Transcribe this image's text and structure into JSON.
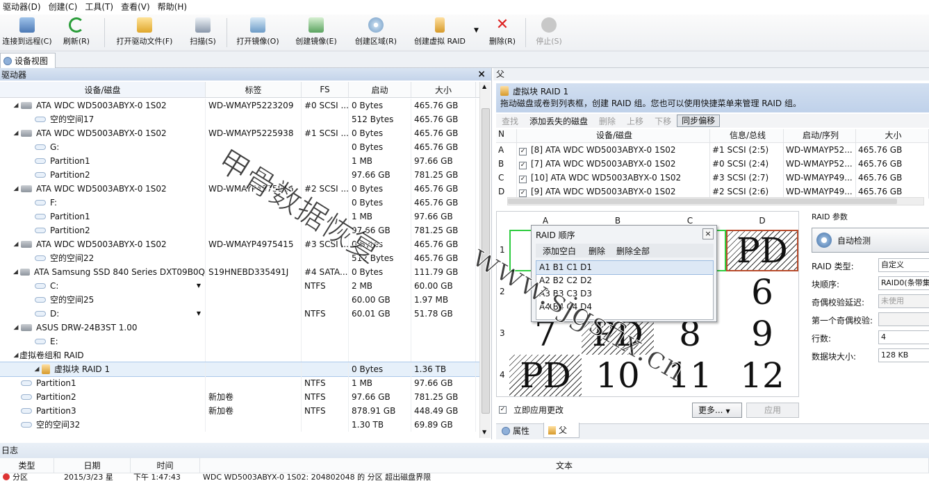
{
  "menu": [
    "驱动器(D)",
    "创建(C)",
    "工具(T)",
    "查看(V)",
    "帮助(H)"
  ],
  "toolbar": {
    "connect": "连接到远程(C)",
    "refresh": "刷新(R)",
    "open_drive_file": "打开驱动文件(F)",
    "scan": "扫描(S)",
    "open_image": "打开镜像(O)",
    "create_image": "创建镜像(E)",
    "create_region": "创建区域(R)",
    "create_virtual_raid": "创建虚拟 RAID",
    "delete": "删除(R)",
    "stop": "停止(S)"
  },
  "tabs": {
    "devices": "设备视图"
  },
  "left": {
    "title": "驱动器",
    "close": "×",
    "columns": [
      "设备/磁盘",
      "标签",
      "FS",
      "启动",
      "大小"
    ],
    "rows": [
      {
        "name": "ATA WDC WD5003ABYX-0 1S02",
        "label": "WD-WMAYP5223209",
        "fs": "#0 SCSI ...",
        "start": "0 Bytes",
        "size": "465.76 GB"
      },
      {
        "name": "空的空间17",
        "label": "",
        "fs": "",
        "start": "512 Bytes",
        "size": "465.76 GB"
      },
      {
        "name": "ATA WDC WD5003ABYX-0 1S02",
        "label": "WD-WMAYP5225938",
        "fs": "#1 SCSI ...",
        "start": "0 Bytes",
        "size": "465.76 GB"
      },
      {
        "name": "G:",
        "label": "",
        "fs": "",
        "start": "0 Bytes",
        "size": "465.76 GB"
      },
      {
        "name": "Partition1",
        "label": "",
        "fs": "",
        "start": "1 MB",
        "size": "97.66 GB"
      },
      {
        "name": "Partition2",
        "label": "",
        "fs": "",
        "start": "97.66 GB",
        "size": "781.25 GB"
      },
      {
        "name": "ATA WDC WD5003ABYX-0 1S02",
        "label": "WD-WMAYP4975816",
        "fs": "#2 SCSI ...",
        "start": "0 Bytes",
        "size": "465.76 GB"
      },
      {
        "name": "F:",
        "label": "",
        "fs": "",
        "start": "0 Bytes",
        "size": "465.76 GB"
      },
      {
        "name": "Partition1",
        "label": "",
        "fs": "",
        "start": "1 MB",
        "size": "97.66 GB"
      },
      {
        "name": "Partition2",
        "label": "",
        "fs": "",
        "start": "97.66 GB",
        "size": "781.25 GB"
      },
      {
        "name": "ATA WDC WD5003ABYX-0 1S02",
        "label": "WD-WMAYP4975415",
        "fs": "#3 SCSI ...",
        "start": "0 Bytes",
        "size": "465.76 GB"
      },
      {
        "name": "空的空间22",
        "label": "",
        "fs": "",
        "start": "512 Bytes",
        "size": "465.76 GB"
      },
      {
        "name": "ATA Samsung SSD 840 Series DXT09B0Q",
        "label": "S19HNEBD335491J",
        "fs": "#4 SATA...",
        "start": "0 Bytes",
        "size": "111.79 GB"
      },
      {
        "name": "C:",
        "label": "",
        "fs": "NTFS",
        "start": "2 MB",
        "size": "60.00 GB"
      },
      {
        "name": "空的空间25",
        "label": "",
        "fs": "",
        "start": "60.00 GB",
        "size": "1.97 MB"
      },
      {
        "name": "D:",
        "label": "",
        "fs": "NTFS",
        "start": "60.01 GB",
        "size": "51.78 GB"
      },
      {
        "name": "ASUS DRW-24B3ST 1.00",
        "label": "",
        "fs": "",
        "start": "",
        "size": ""
      },
      {
        "name": "E:",
        "label": "",
        "fs": "",
        "start": "",
        "size": ""
      },
      {
        "name": "虚拟卷组和 RAID",
        "label": "",
        "fs": "",
        "start": "",
        "size": ""
      },
      {
        "name": "虚拟块 RAID 1",
        "label": "",
        "fs": "",
        "start": "0 Bytes",
        "size": "1.36 TB"
      },
      {
        "name": "Partition1",
        "label": "",
        "fs": "NTFS",
        "start": "1 MB",
        "size": "97.66 GB"
      },
      {
        "name": "Partition2",
        "label": "新加卷",
        "fs": "NTFS",
        "start": "97.66 GB",
        "size": "781.25 GB"
      },
      {
        "name": "Partition3",
        "label": "新加卷",
        "fs": "NTFS",
        "start": "878.91 GB",
        "size": "448.49 GB"
      },
      {
        "name": "空的空间32",
        "label": "",
        "fs": "",
        "start": "1.30 TB",
        "size": "69.89 GB"
      }
    ]
  },
  "right": {
    "title": "父",
    "header_title": "虚拟块 RAID 1",
    "header_desc": "拖动磁盘或卷到列表框，创建 RAID 组。您也可以使用快捷菜单来管理 RAID 组。",
    "tools": {
      "find": "查找",
      "add_missing": "添加丢失的磁盘",
      "delete": "删除",
      "up": "上移",
      "down": "下移",
      "sync": "同步偏移"
    },
    "columns": [
      "N",
      "设备/磁盘",
      "信息/总线",
      "启动/序列",
      "大小"
    ],
    "rows": [
      {
        "n": "A",
        "disk": "[8] ATA WDC WD5003ABYX-0 1S02",
        "bus": "#1 SCSI (2:5)",
        "serial": "WD-WMAYP52...",
        "size": "465.76 GB"
      },
      {
        "n": "B",
        "disk": "[7] ATA WDC WD5003ABYX-0 1S02",
        "bus": "#0 SCSI (2:4)",
        "serial": "WD-WMAYP52...",
        "size": "465.76 GB"
      },
      {
        "n": "C",
        "disk": "[10] ATA WDC WD5003ABYX-0 1S02",
        "bus": "#3 SCSI (2:7)",
        "serial": "WD-WMAYP49...",
        "size": "465.76 GB"
      },
      {
        "n": "D",
        "disk": "[9] ATA WDC WD5003ABYX-0 1S02",
        "bus": "#2 SCSI (2:6)",
        "serial": "WD-WMAYP49...",
        "size": "465.76 GB"
      }
    ],
    "matrix": {
      "cols": [
        "A",
        "B",
        "C",
        "D"
      ],
      "rows": [
        "1",
        "2",
        "3",
        "4"
      ],
      "cells": [
        "",
        "",
        "",
        "PD",
        "",
        "",
        "",
        "6",
        "7",
        "PD",
        "8",
        "9",
        "PD",
        "10",
        "11",
        "12"
      ]
    },
    "apply_now": "立即应用更改",
    "more": "更多...",
    "apply": "应用",
    "bottom_tabs": {
      "props": "属性",
      "parent": "父"
    }
  },
  "dialog": {
    "title": "RAID 顺序",
    "close": "×",
    "add_blank": "添加空白",
    "delete": "删除",
    "delete_all": "删除全部",
    "items": [
      "A1 B1 C1 D1",
      "A2 B2 C2 D2",
      "A3 B3 C3 D3",
      "A4 B4 C4 D4"
    ]
  },
  "params": {
    "title": "RAID 参数",
    "auto_detect": "自动检测",
    "raid_type_label": "RAID 类型:",
    "raid_type": "自定义",
    "block_order_label": "块顺序:",
    "block_order": "RAID0(条带集",
    "parity_delay_label": "奇偶校验延迟:",
    "parity_delay": "未使用",
    "first_parity_label": "第一个奇偶校验:",
    "first_parity": "",
    "rows_label": "行数:",
    "rows": "4",
    "block_size_label": "数据块大小:",
    "block_size": "128 KB"
  },
  "log": {
    "title": "日志",
    "columns": [
      "类型",
      "日期",
      "时间",
      "文本"
    ],
    "row": {
      "type": "分区",
      "date": "2015/3/23 星",
      "time": "下午 1:47:43",
      "text": "WDC WD5003ABYX-0 1S02: 204802048 的 分区 超出磁盘界限"
    }
  },
  "watermark": {
    "cn": "甲骨数据恢复",
    "url": "www.sjgsfix.cn"
  },
  "colors": {
    "accent": "#c4d4ea",
    "green": "#2ecc40",
    "selection": "#e6f0fa"
  }
}
